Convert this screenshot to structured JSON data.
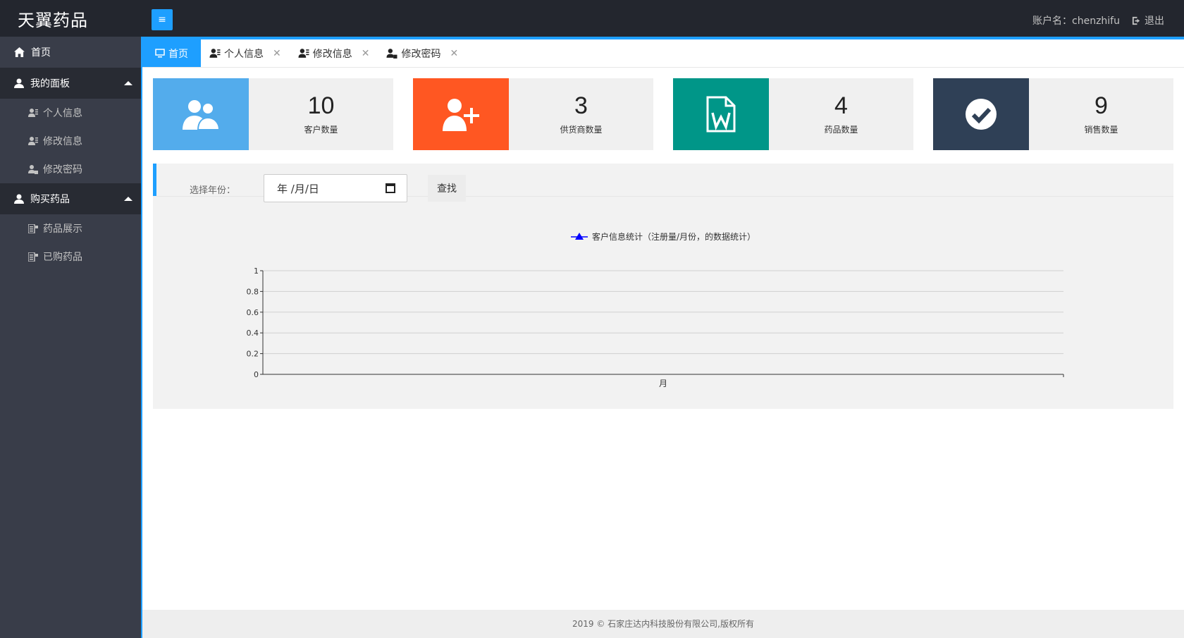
{
  "header": {
    "logo": "天翼药品",
    "menu_icon": "menu-icon",
    "account_label": "账户名：chenzhifu",
    "logout_label": "退出"
  },
  "sidebar": {
    "home": "首页",
    "groups": [
      {
        "label": "我的面板",
        "items": [
          "个人信息",
          "修改信息",
          "修改密码"
        ]
      },
      {
        "label": "购买药品",
        "items": [
          "药品展示",
          "已购药品"
        ]
      }
    ]
  },
  "tabs": [
    {
      "label": "首页"
    },
    {
      "label": "个人信息"
    },
    {
      "label": "修改信息"
    },
    {
      "label": "修改密码"
    }
  ],
  "stats": [
    {
      "value": "10",
      "label": "客户数量",
      "color": "#53acec",
      "icon": "users-icon"
    },
    {
      "value": "3",
      "label": "供货商数量",
      "color": "#ff5722",
      "icon": "add-user-icon"
    },
    {
      "value": "4",
      "label": "药品数量",
      "color": "#009688",
      "icon": "word-file-icon"
    },
    {
      "value": "9",
      "label": "销售数量",
      "color": "#2f4056",
      "icon": "check-circle-icon"
    }
  ],
  "filter": {
    "label": "选择年份：",
    "date_placeholder": "年 /月/日",
    "search_label": "查找"
  },
  "chart_data": {
    "type": "line",
    "series": [
      {
        "name": "客户信息统计（注册量/月份，的数据统计）",
        "values": []
      }
    ],
    "categories": [],
    "xlabel": "月",
    "ylabel": "",
    "ylim": [
      0,
      1
    ],
    "yticks": [
      "0",
      "0.2",
      "0.4",
      "0.6",
      "0.8",
      "1"
    ],
    "grid": true,
    "legend": "top-center",
    "color": "#0000ff"
  },
  "footer": {
    "text": "2019 © 石家庄达内科技股份有限公司,版权所有"
  }
}
